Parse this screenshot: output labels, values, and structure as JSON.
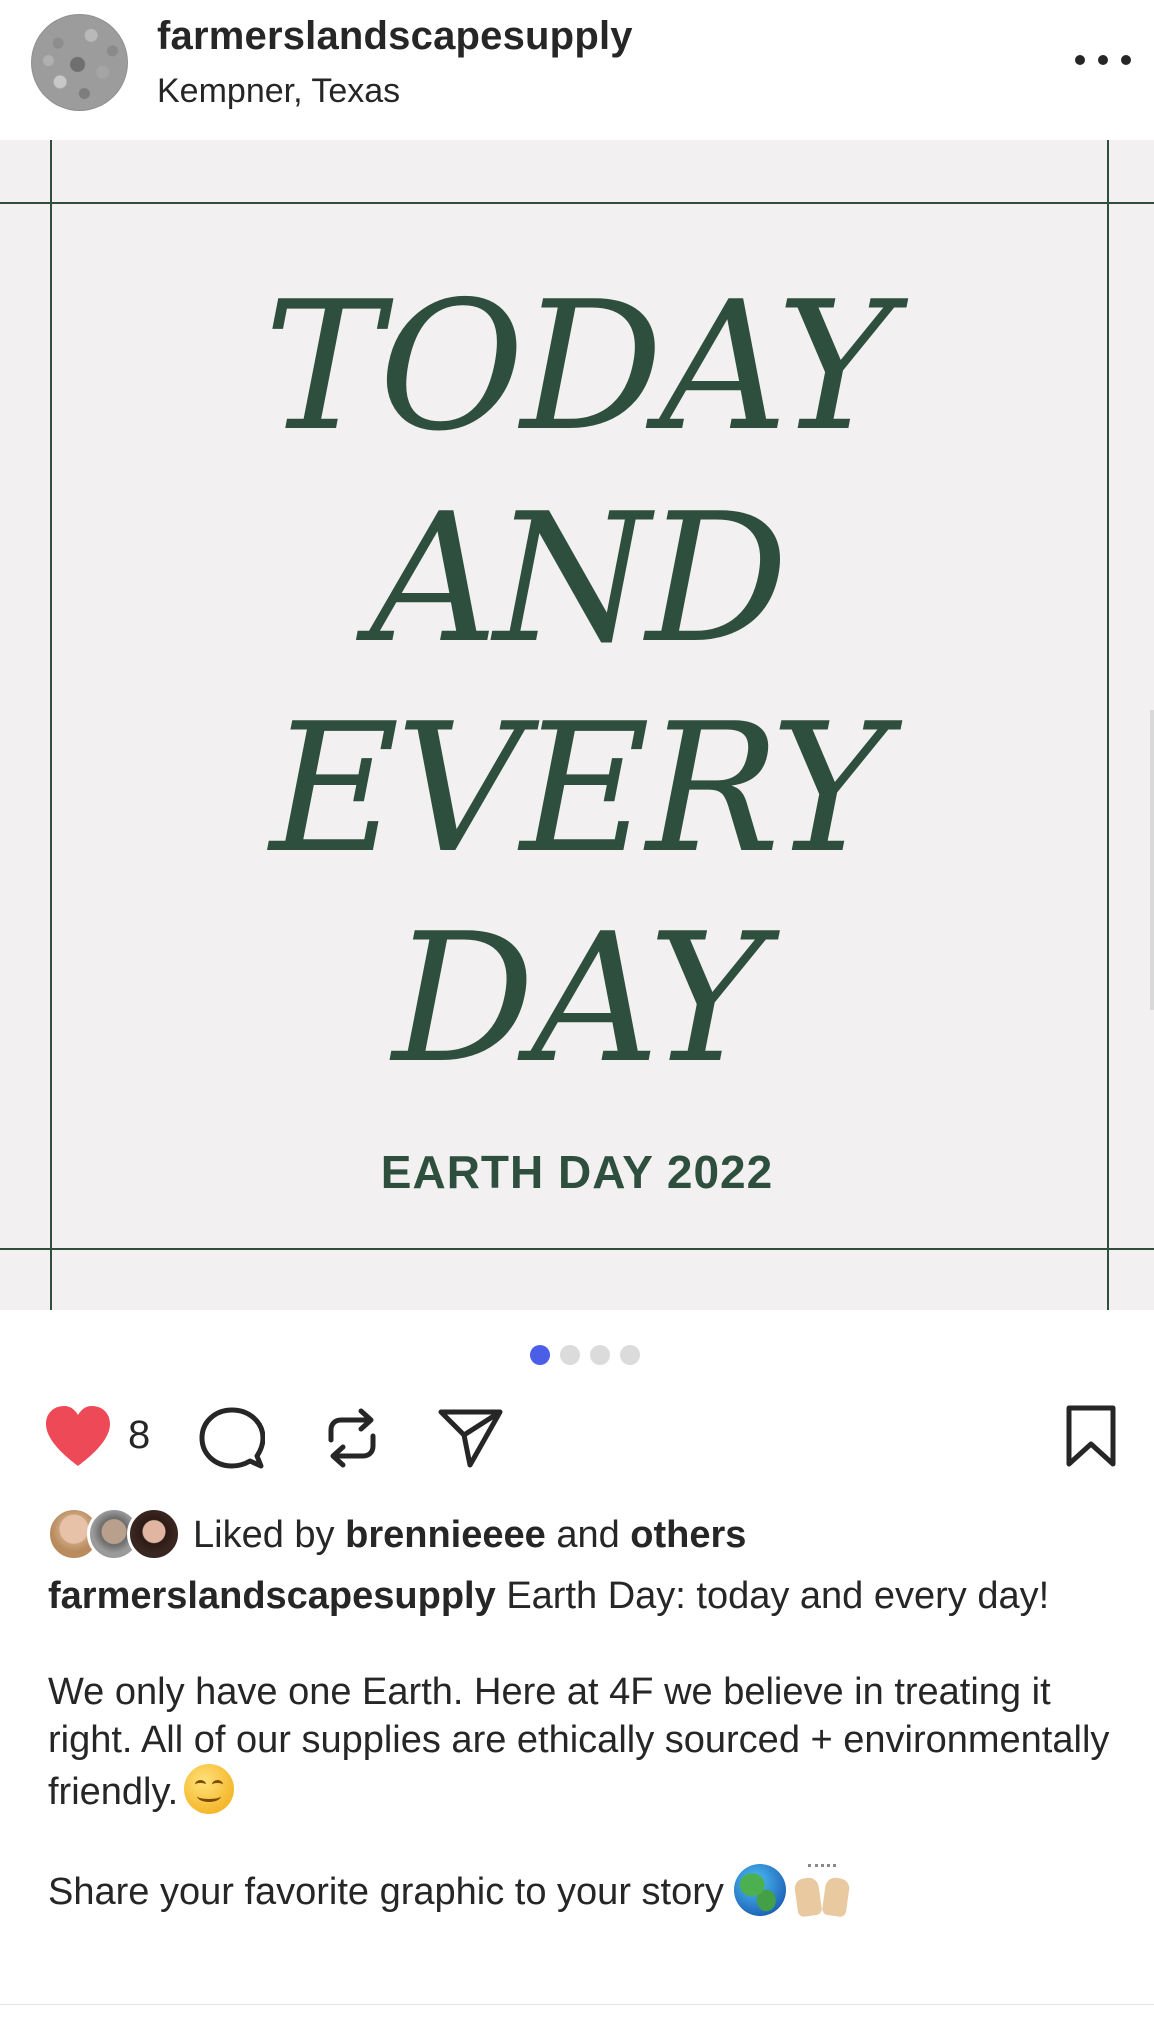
{
  "header": {
    "username": "farmerslandscapesupply",
    "location": "Kempner, Texas",
    "avatar_icon": "gravel-avatar",
    "more_icon": "more-horizontal-icon"
  },
  "image": {
    "lines": [
      "TODAY",
      "AND",
      "EVERY",
      "DAY"
    ],
    "subtitle": "EARTH DAY 2022",
    "background_color": "#f2f0f1",
    "ink_color": "#2f4f3e"
  },
  "carousel": {
    "total": 4,
    "active_index": 0,
    "active_color": "#4a5ee8",
    "inactive_color": "#dbdbdb"
  },
  "actions": {
    "like_count": "8",
    "heart_color": "#ed4956",
    "icons": [
      "heart-icon",
      "comment-icon",
      "repost-icon",
      "share-icon",
      "bookmark-icon"
    ]
  },
  "likes": {
    "prefix": "Liked by",
    "user": "brennieeee",
    "connector": "and",
    "others": "others"
  },
  "caption": {
    "username": "farmerslandscapesupply",
    "line1": "Earth Day: today and every day!",
    "paragraph2": "We only have one Earth. Here at 4F we believe in treating it right. All of our supplies are ethically sourced + environmentally friendly.",
    "paragraph3": "Share your favorite graphic to your story"
  }
}
